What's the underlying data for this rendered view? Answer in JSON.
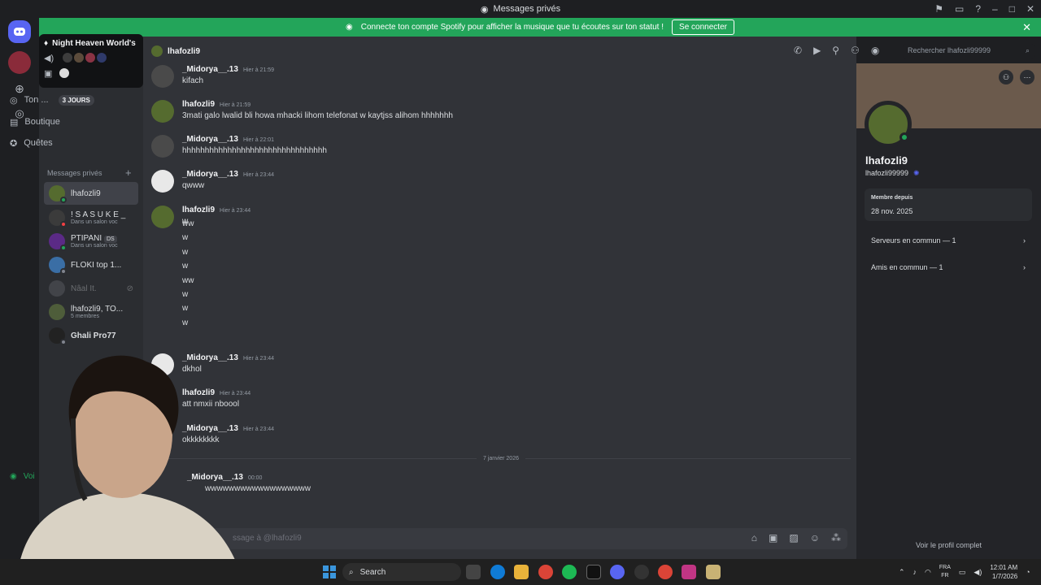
{
  "window": {
    "title": "Messages privés"
  },
  "banner": {
    "text": "Connecte ton compte Spotify pour afficher la musique que tu écoutes sur ton statut !",
    "button": "Se connecter"
  },
  "popup": {
    "server_name": "Night Heaven World's"
  },
  "sidebar": {
    "nitro": {
      "label": "Ton ...",
      "badge": "3 JOURS"
    },
    "shop": "Boutique",
    "quests": "Quêtes",
    "dm_header": "Messages privés",
    "dms": [
      {
        "name": "lhafozli9",
        "sub": ""
      },
      {
        "name": "! S A S U K E _",
        "sub": "Dans un salon voc"
      },
      {
        "name": "PTIPANI",
        "tag": "DS",
        "sub": "Dans un salon voc"
      },
      {
        "name": "FLOKI top 1...",
        "sub": ""
      },
      {
        "name": "Nâal It.",
        "sub": ""
      },
      {
        "name": "lhafozli9, TO...",
        "sub": "5 membres"
      },
      {
        "name": "Ghali Pro77",
        "sub": ""
      }
    ],
    "voice_label": "Voi"
  },
  "chat": {
    "channel_name": "lhafozli9",
    "search_placeholder": "Rechercher lhafozli99999",
    "messages": [
      {
        "user": "_Midorya__.13",
        "time": "Hier à 21:59",
        "text": "kifach"
      },
      {
        "user": "lhafozli9",
        "time": "Hier à 21:59",
        "text": "3mati galo lwalid bli howa mhacki lihom telefonat w kaytjss alihom hhhhhhh"
      },
      {
        "user": "_Midorya__.13",
        "time": "Hier à 22:01",
        "text": "hhhhhhhhhhhhhhhhhhhhhhhhhhhhhhhh"
      },
      {
        "user": "_Midorya__.13",
        "time": "Hier à 23:44",
        "text": "qwww"
      },
      {
        "user": "lhafozli9",
        "time": "Hier à 23:44",
        "text": "w"
      },
      {
        "user": "_Midorya__.13",
        "time": "Hier à 23:44",
        "text": "dkhol"
      },
      {
        "user": "lhafozli9",
        "time": "Hier à 23:44",
        "text": "att nmxii nboool"
      },
      {
        "user": "_Midorya__.13",
        "time": "Hier à 23:44",
        "text": "okkkkkkkk"
      },
      {
        "user": "_Midorya__.13",
        "time": "00:00",
        "text": "wwwwwwwwwwwwwwwwww"
      }
    ],
    "multi_lines": [
      "ww",
      "w",
      "w",
      "w",
      "ww",
      "w",
      "w",
      "w"
    ],
    "date_divider": "7 janvier 2026",
    "composer_placeholder": "ssage à @lhafozli9"
  },
  "profile": {
    "display_name": "lhafozli9",
    "username": "lhafozli99999",
    "member_since_label": "Membre depuis",
    "member_since": "28 nov. 2025",
    "mutual_servers": "Serveurs en commun — 1",
    "mutual_friends": "Amis en commun — 1",
    "footer": "Voir le profil complet"
  },
  "taskbar": {
    "search": "Search",
    "lang_top": "FRA",
    "lang_bottom": "FR",
    "time": "12:01 AM",
    "date": "1/7/2026"
  },
  "colors": {
    "accent": "#5865f2",
    "online": "#23a55a",
    "banner": "#23a55a"
  }
}
